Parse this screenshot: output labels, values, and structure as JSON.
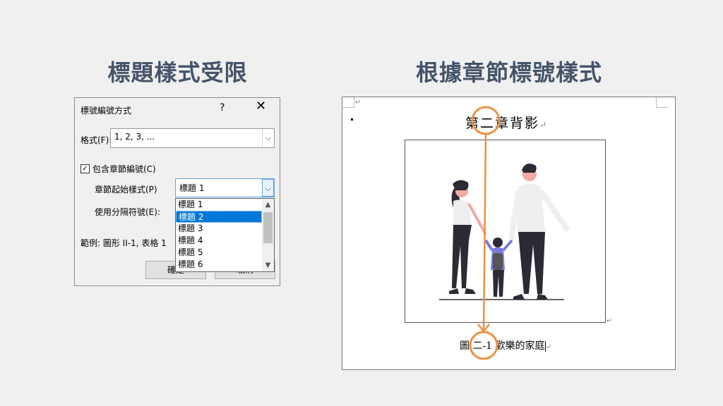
{
  "headings": {
    "left": "標題樣式受限",
    "right": "根據章節標號樣式"
  },
  "dialog": {
    "title": "標號編號方式",
    "help": "?",
    "close": "✕",
    "format_label": "格式(F):",
    "format_value": "1, 2, 3, ...",
    "include_chapter": "包含章節編號(C)",
    "include_checked": true,
    "chapter_style_label": "章節起始樣式(P)",
    "chapter_style_value": "標題 1",
    "separator_label": "使用分隔符號(E):",
    "example_label": "範例: 圖形 II-1, 表格 1",
    "ok": "確定",
    "cancel": "取消",
    "options": [
      "標題 1",
      "標題 2",
      "標題 3",
      "標題 4",
      "標題 5",
      "標題 6"
    ],
    "selected_index": 1
  },
  "document": {
    "title": "第二章背影",
    "caption": "圖 二-1 歡樂的家庭",
    "para_mark": "↵"
  },
  "colors": {
    "heading": "#44546a",
    "accent": "#ed9040",
    "selection": "#0078d7"
  }
}
